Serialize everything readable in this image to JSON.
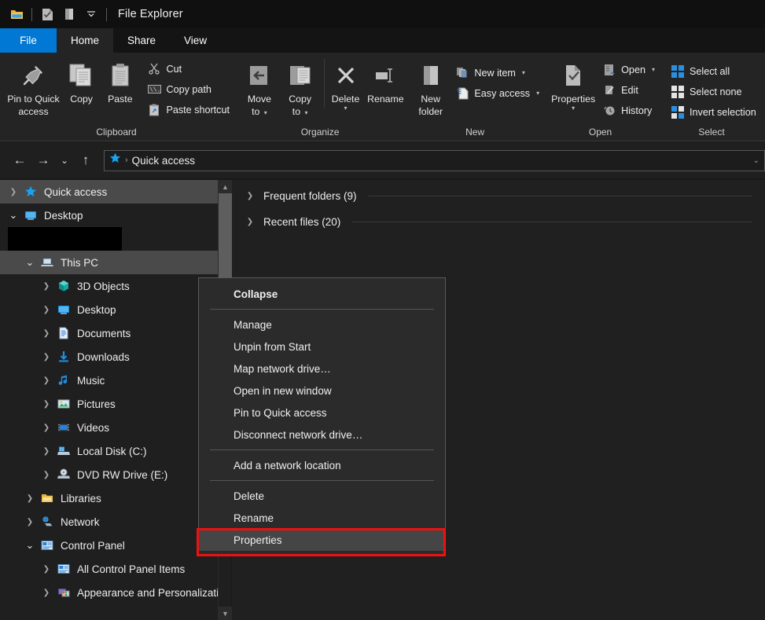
{
  "window": {
    "title": "File Explorer",
    "quick_access_toolbar": [
      {
        "name": "folder-icon",
        "label": "File Explorer"
      },
      {
        "name": "properties-icon",
        "label": "Properties"
      },
      {
        "name": "new-folder-icon",
        "label": "New folder"
      },
      {
        "name": "chevron-down-icon",
        "label": "Customize Quick Access Toolbar"
      }
    ]
  },
  "tabs": [
    {
      "label": "File",
      "kind": "file"
    },
    {
      "label": "Home",
      "kind": "active"
    },
    {
      "label": "Share",
      "kind": "normal"
    },
    {
      "label": "View",
      "kind": "normal"
    }
  ],
  "ribbon": {
    "clipboard": {
      "label": "Clipboard",
      "pin": {
        "line1": "Pin to Quick",
        "line2": "access",
        "icon": "pin-icon"
      },
      "copy": {
        "label": "Copy",
        "icon": "copy-icon"
      },
      "paste": {
        "label": "Paste",
        "icon": "paste-icon"
      },
      "small": [
        {
          "label": "Cut",
          "icon": "scissors-icon"
        },
        {
          "label": "Copy path",
          "icon": "copy-path-icon"
        },
        {
          "label": "Paste shortcut",
          "icon": "paste-shortcut-icon"
        }
      ]
    },
    "organize": {
      "label": "Organize",
      "move_to": {
        "line1": "Move",
        "line2": "to",
        "icon": "move-to-icon"
      },
      "copy_to": {
        "line1": "Copy",
        "line2": "to",
        "icon": "copy-to-icon"
      },
      "delete": {
        "label": "Delete",
        "icon": "delete-icon"
      },
      "rename": {
        "label": "Rename",
        "icon": "rename-icon"
      }
    },
    "new": {
      "label": "New",
      "new_folder": {
        "line1": "New",
        "line2": "folder",
        "icon": "new-folder-icon"
      },
      "small": [
        {
          "label": "New item",
          "icon": "new-item-icon"
        },
        {
          "label": "Easy access",
          "icon": "easy-access-icon"
        }
      ]
    },
    "open": {
      "label": "Open",
      "properties": {
        "label": "Properties",
        "icon": "properties-icon"
      },
      "small": [
        {
          "label": "Open",
          "icon": "open-icon"
        },
        {
          "label": "Edit",
          "icon": "edit-icon"
        },
        {
          "label": "History",
          "icon": "history-icon"
        }
      ]
    },
    "select": {
      "label": "Select",
      "small": [
        {
          "label": "Select all",
          "icon": "select-all-icon"
        },
        {
          "label": "Select none",
          "icon": "select-none-icon"
        },
        {
          "label": "Invert selection",
          "icon": "invert-selection-icon"
        }
      ]
    }
  },
  "addressbar": {
    "back": "←",
    "forward": "→",
    "recent": "⌄",
    "up": "↑",
    "crumb_icon": "quick-access-star-icon",
    "crumb_sep": "›",
    "crumb_text": "Quick access",
    "dropdown": "⌄"
  },
  "sidebar": {
    "items": [
      {
        "label": "Quick access",
        "indent": 0,
        "chev": "collapsed",
        "icon": "star-icon",
        "selected": true
      },
      {
        "label": "Desktop",
        "indent": 0,
        "chev": "expanded",
        "icon": "desktop-icon",
        "selected": false
      },
      {
        "label": "",
        "indent": 1,
        "chev": "none",
        "icon": "none",
        "redacted": true
      },
      {
        "label": "This PC",
        "indent": 1,
        "chev": "expanded",
        "icon": "this-pc-icon",
        "selected": true
      },
      {
        "label": "3D Objects",
        "indent": 2,
        "chev": "collapsed",
        "icon": "3d-objects-icon",
        "selected": false
      },
      {
        "label": "Desktop",
        "indent": 2,
        "chev": "collapsed",
        "icon": "desktop-icon",
        "selected": false
      },
      {
        "label": "Documents",
        "indent": 2,
        "chev": "collapsed",
        "icon": "documents-icon",
        "selected": false
      },
      {
        "label": "Downloads",
        "indent": 2,
        "chev": "collapsed",
        "icon": "downloads-icon",
        "selected": false
      },
      {
        "label": "Music",
        "indent": 2,
        "chev": "collapsed",
        "icon": "music-icon",
        "selected": false
      },
      {
        "label": "Pictures",
        "indent": 2,
        "chev": "collapsed",
        "icon": "pictures-icon",
        "selected": false
      },
      {
        "label": "Videos",
        "indent": 2,
        "chev": "collapsed",
        "icon": "videos-icon",
        "selected": false
      },
      {
        "label": "Local Disk (C:)",
        "indent": 2,
        "chev": "collapsed",
        "icon": "local-disk-icon",
        "selected": false
      },
      {
        "label": "DVD RW Drive (E:)",
        "indent": 2,
        "chev": "collapsed",
        "icon": "dvd-drive-icon",
        "selected": false
      },
      {
        "label": "Libraries",
        "indent": 1,
        "chev": "collapsed",
        "icon": "libraries-icon",
        "selected": false
      },
      {
        "label": "Network",
        "indent": 1,
        "chev": "collapsed",
        "icon": "network-icon",
        "selected": false
      },
      {
        "label": "Control Panel",
        "indent": 1,
        "chev": "expanded",
        "icon": "control-panel-icon",
        "selected": false
      },
      {
        "label": "All Control Panel Items",
        "indent": 2,
        "chev": "collapsed",
        "icon": "control-panel-icon",
        "selected": false
      },
      {
        "label": "Appearance and Personalization",
        "indent": 2,
        "chev": "collapsed",
        "icon": "appearance-icon",
        "selected": false
      }
    ]
  },
  "content": {
    "sections": [
      {
        "label": "Frequent folders (9)",
        "chev": "collapsed"
      },
      {
        "label": "Recent files (20)",
        "chev": "collapsed"
      }
    ]
  },
  "context_menu": {
    "items": [
      {
        "label": "Collapse",
        "bold": true,
        "highlight": false
      },
      {
        "sep": true
      },
      {
        "label": "Manage",
        "bold": false,
        "highlight": false
      },
      {
        "label": "Unpin from Start",
        "bold": false,
        "highlight": false
      },
      {
        "label": "Map network drive…",
        "bold": false,
        "highlight": false
      },
      {
        "label": "Open in new window",
        "bold": false,
        "highlight": false
      },
      {
        "label": "Pin to Quick access",
        "bold": false,
        "highlight": false
      },
      {
        "label": "Disconnect network drive…",
        "bold": false,
        "highlight": false
      },
      {
        "sep": true
      },
      {
        "label": "Add a network location",
        "bold": false,
        "highlight": false
      },
      {
        "sep": true
      },
      {
        "label": "Delete",
        "bold": false,
        "highlight": false
      },
      {
        "label": "Rename",
        "bold": false,
        "highlight": false
      },
      {
        "label": "Properties",
        "bold": false,
        "highlight": true
      }
    ]
  },
  "annotation": {
    "color": "#ee1111",
    "target": "Properties"
  }
}
